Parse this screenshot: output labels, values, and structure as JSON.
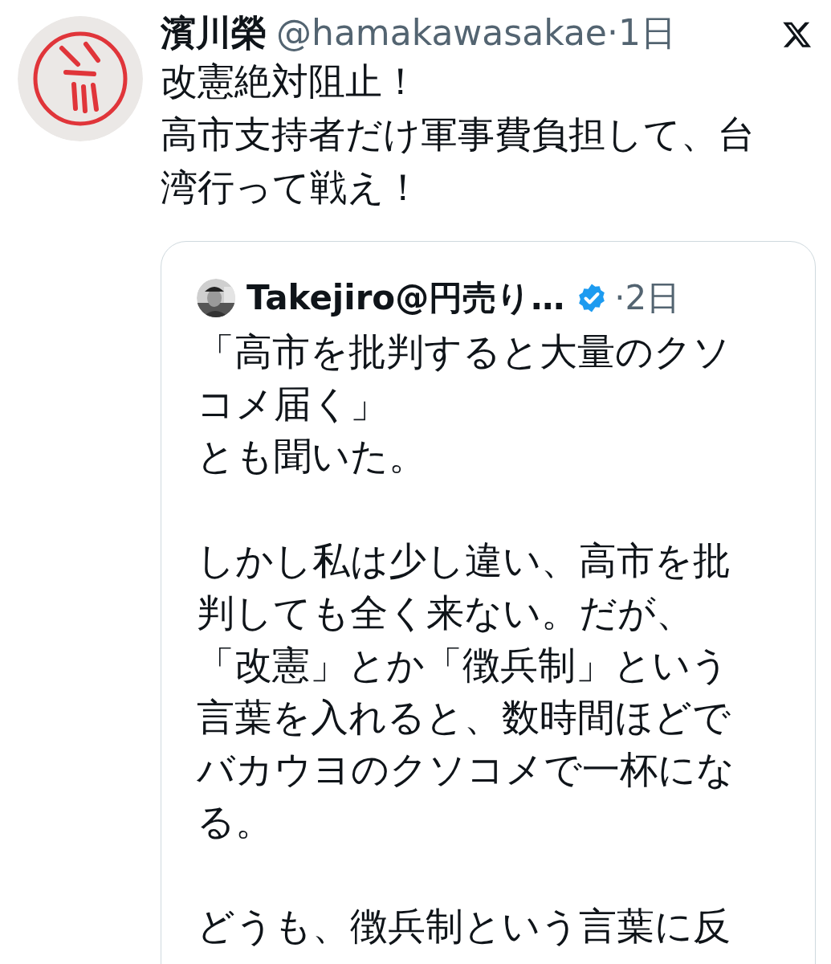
{
  "post": {
    "author": {
      "name": "濱川榮",
      "handle": "@hamakawasakae",
      "time": "·1日"
    },
    "text": [
      "改憲絶対阻止！",
      "高市支持者だけ軍事費負担して、台湾行って戦え！"
    ],
    "quote": {
      "author": {
        "name": "Takejiro@円売り…",
        "verified": true,
        "time": "·2日"
      },
      "paragraphs": [
        [
          "「高市を批判すると大量のクソコメ届く」",
          "とも聞いた。"
        ],
        [
          "しかし私は少し違い、高市を批判しても全く来ない。だが、「改憲」とか「徴兵制」という言葉を入れると、数時間ほどでバカウヨのクソコメで一杯になる。"
        ],
        [
          "どうも、徴兵制という言葉に反"
        ]
      ]
    }
  }
}
